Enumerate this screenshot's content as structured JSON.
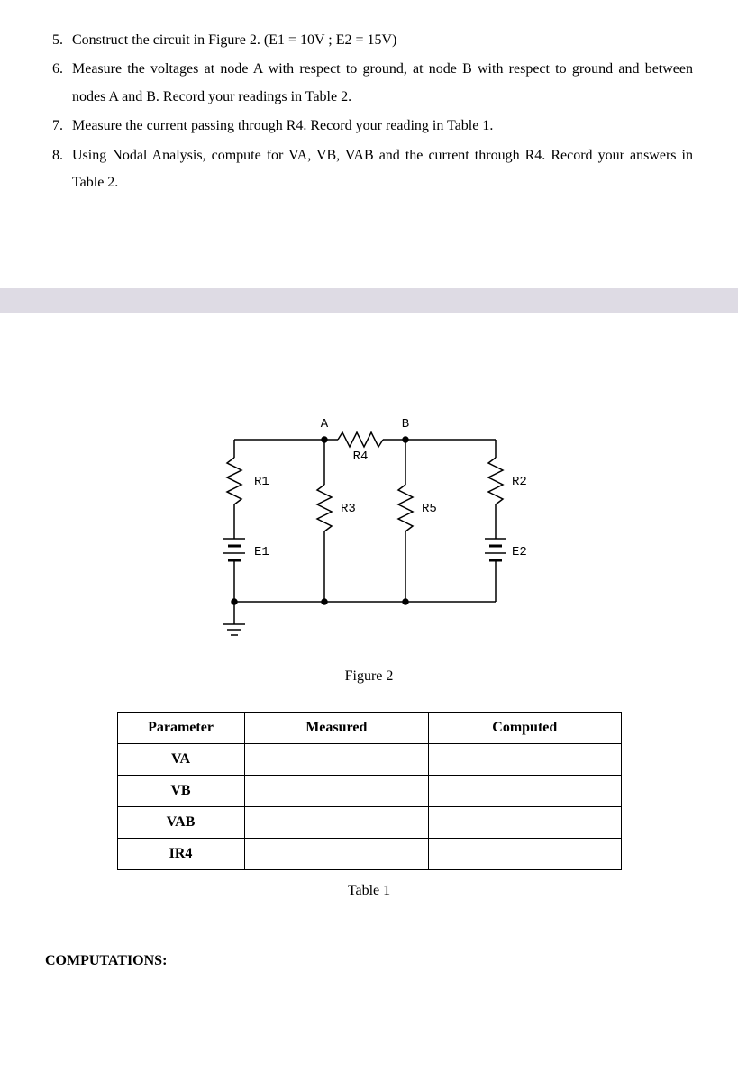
{
  "steps": [
    "Construct the circuit in Figure 2. (E1 = 10V ; E2 = 15V)",
    "Measure the voltages at node A with respect to ground, at node B with respect to ground and between nodes A and B. Record your readings in Table 2.",
    "Measure the current passing through R4. Record your reading in Table 1.",
    "Using Nodal Analysis, compute for VA, VB, VAB and the current through R4. Record your answers in Table 2."
  ],
  "steps_start": 5,
  "figure": {
    "caption": "Figure 2",
    "nodes": {
      "A": "A",
      "B": "B"
    },
    "components": {
      "R1": "R1",
      "R2": "R2",
      "R3": "R3",
      "R4": "R4",
      "R5": "R5",
      "E1": "E1",
      "E2": "E2"
    }
  },
  "table": {
    "caption": "Table 1",
    "headers": {
      "param": "Parameter",
      "measured": "Measured",
      "computed": "Computed"
    },
    "rows": [
      {
        "param": "VA",
        "measured": "",
        "computed": ""
      },
      {
        "param": "VB",
        "measured": "",
        "computed": ""
      },
      {
        "param": "VAB",
        "measured": "",
        "computed": ""
      },
      {
        "param": "IR4",
        "measured": "",
        "computed": ""
      }
    ]
  },
  "computations_heading": "COMPUTATIONS:"
}
